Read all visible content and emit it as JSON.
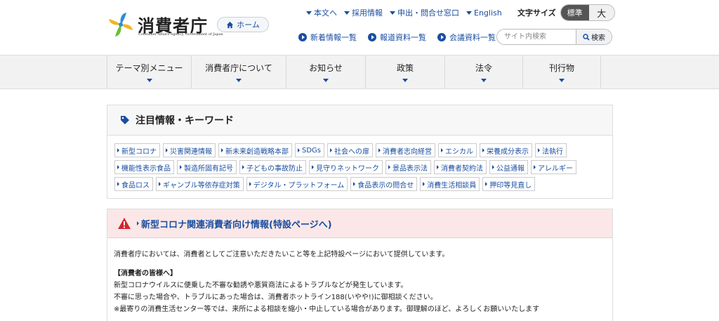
{
  "header": {
    "logo_title": "消費者庁",
    "logo_subtitle": "Consumer Affairs Agency, Government of Japan",
    "home_label": "ホーム",
    "top_links": [
      "本文へ",
      "採用情報",
      "申出・問合せ窓口",
      "English"
    ],
    "font_size_label": "文字サイズ",
    "font_size_standard": "標準",
    "font_size_large": "大",
    "sub_links": [
      "新着情報一覧",
      "報道資料一覧",
      "会議資料一覧"
    ],
    "search_placeholder": "サイト内検索",
    "search_button": "検索"
  },
  "nav": {
    "items": [
      "テーマ別メニュー",
      "消費者庁について",
      "お知らせ",
      "政策",
      "法令",
      "刊行物"
    ]
  },
  "keywords": {
    "title": "注目情報・キーワード",
    "tags": [
      "新型コロナ",
      "災害関連情報",
      "新未来創造戦略本部",
      "SDGs",
      "社会への扉",
      "消費者志向経営",
      "エシカル",
      "栄養成分表示",
      "法執行",
      "機能性表示食品",
      "製造所固有記号",
      "子どもの事故防止",
      "見守りネットワーク",
      "景品表示法",
      "消費者契約法",
      "公益通報",
      "アレルギー",
      "食品ロス",
      "ギャンブル等依存症対策",
      "デジタル・プラットフォーム",
      "食品表示の問合せ",
      "消費生活相談員",
      "押印等見直し"
    ]
  },
  "corona": {
    "title": "新型コロナ関連消費者向け情報(特設ページへ)",
    "intro": "消費者庁においては、消費者としてご注意いただきたいこと等を上記特設ページにおいて提供しています。",
    "heading": "【消費者の皆様へ】",
    "lines": [
      "新型コロナウイルスに便乗した不審な勧誘や悪質商法によるトラブルなどが発生しています。",
      "不審に思った場合や、トラブルにあった場合は、消費者ホットライン188(いやや!)に御相談ください。",
      "※最寄りの消費生活センター等では、来所による相談を縮小・中止している場合があります。御理解のほど、よろしくお願いいたします"
    ]
  },
  "colors": {
    "link": "#1a4ea0",
    "alert_bg": "#fbe7e7",
    "alert_icon": "#d0262f"
  }
}
